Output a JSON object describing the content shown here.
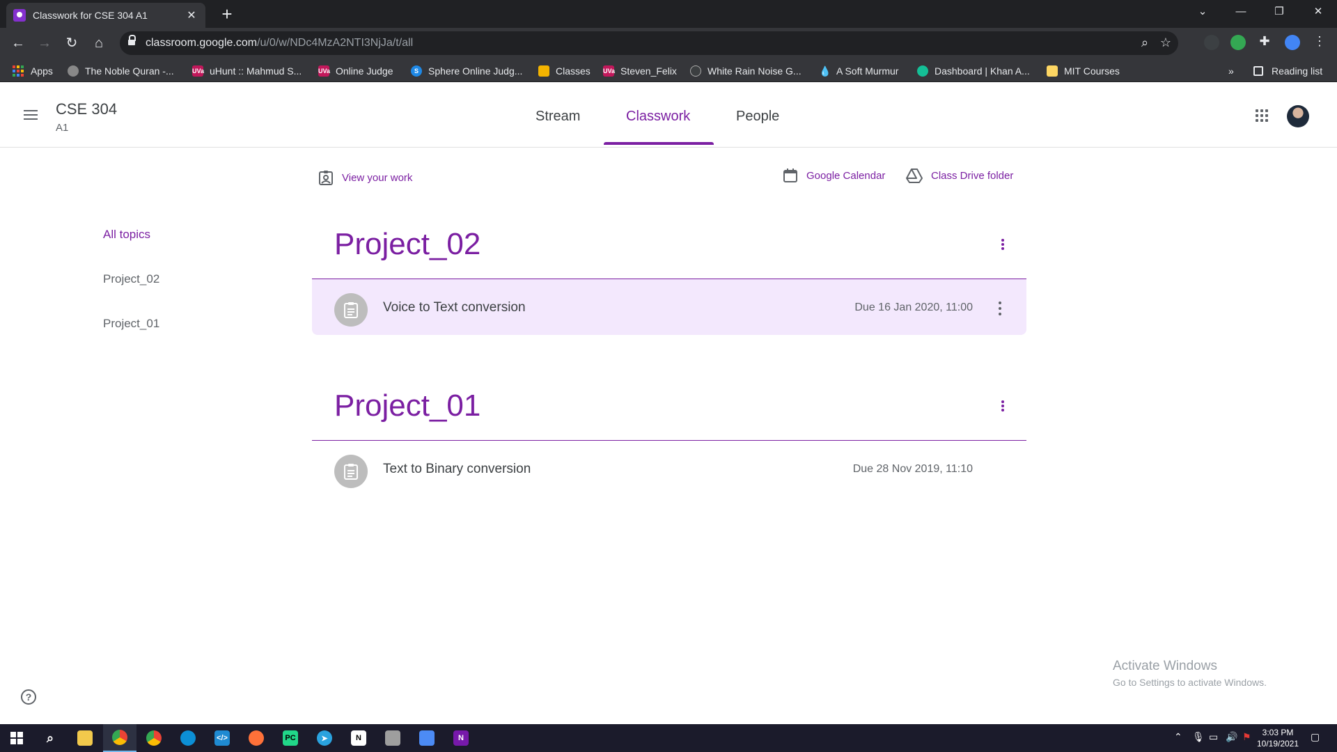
{
  "browser": {
    "tab_title": "Classwork for CSE 304 A1",
    "tab_close": "✕",
    "new_tab": "+",
    "url_host": "classroom.google.com",
    "url_path": "/u/0/w/NDc4MzA2NTI3NjJa/t/all",
    "window_controls": {
      "tabsearch": "⌄",
      "minimize": "—",
      "restore": "❐",
      "close": "✕"
    },
    "reading_list": "Reading list",
    "more_bookmarks": "»"
  },
  "bookmarks": [
    {
      "label": "Apps",
      "icon": "apps-grid-icon"
    },
    {
      "label": "The Noble Quran -...",
      "icon": "quran-icon",
      "color": "#888888"
    },
    {
      "label": "uHunt :: Mahmud S...",
      "icon": "uva-icon",
      "color": "#c2185b"
    },
    {
      "label": "Online Judge",
      "icon": "uva-icon",
      "color": "#c2185b"
    },
    {
      "label": "Sphere Online Judg...",
      "icon": "spoj-icon",
      "color": "#1e88e5"
    },
    {
      "label": "Classes",
      "icon": "classroom-icon",
      "color": "#f4b400"
    },
    {
      "label": "Steven_Felix",
      "icon": "uva-icon",
      "color": "#c2185b"
    },
    {
      "label": "White Rain Noise G...",
      "icon": "mynoise-icon",
      "color": "#3c3f41"
    },
    {
      "label": "A Soft Murmur",
      "icon": "drop-icon",
      "color": "#42a5f5"
    },
    {
      "label": "Dashboard | Khan A...",
      "icon": "khan-icon",
      "color": "#14bf96"
    },
    {
      "label": "MIT Courses",
      "icon": "folder-icon",
      "color": "#fdd663"
    }
  ],
  "classroom": {
    "course_title": "CSE 304",
    "course_section": "A1",
    "tabs": [
      {
        "label": "Stream",
        "active": false
      },
      {
        "label": "Classwork",
        "active": true
      },
      {
        "label": "People",
        "active": false
      }
    ],
    "view_your_work": "View your work",
    "google_calendar": "Google Calendar",
    "class_drive_folder": "Class Drive folder",
    "topic_nav": [
      {
        "label": "All topics",
        "active": true
      },
      {
        "label": "Project_02",
        "active": false
      },
      {
        "label": "Project_01",
        "active": false
      }
    ],
    "topics": [
      {
        "title": "Project_02",
        "assignments": [
          {
            "title": "Voice to Text conversion",
            "due": "Due 16 Jan 2020, 11:00",
            "highlighted": true
          }
        ]
      },
      {
        "title": "Project_01",
        "assignments": [
          {
            "title": "Text to Binary conversion",
            "due": "Due 28 Nov 2019, 11:10",
            "highlighted": false
          }
        ]
      }
    ],
    "help": "?",
    "accent_color": "#7b1fa2"
  },
  "watermark": {
    "line1": "Activate Windows",
    "line2": "Go to Settings to activate Windows."
  },
  "taskbar": {
    "time": "3:03 PM",
    "date": "10/19/2021"
  }
}
